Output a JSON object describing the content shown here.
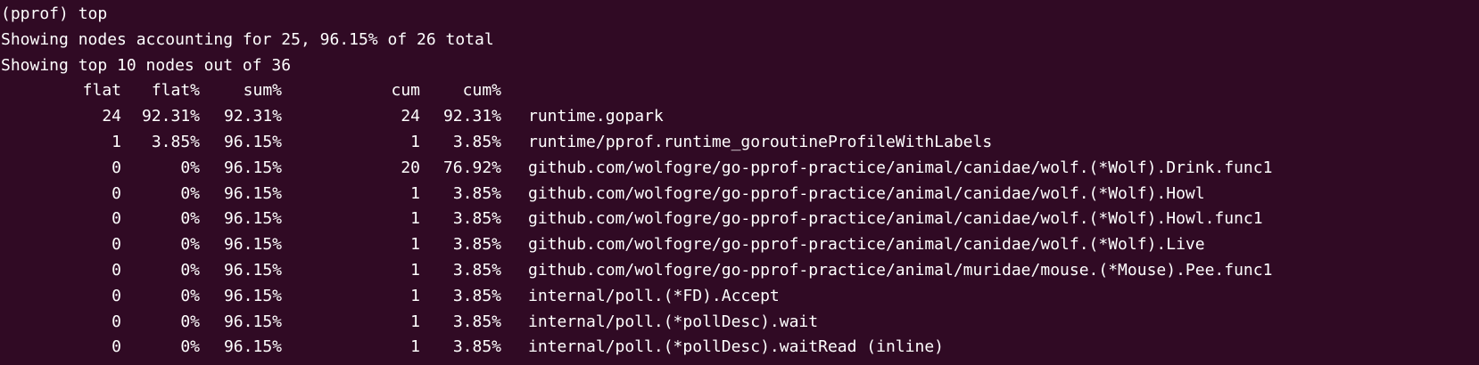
{
  "terminal": {
    "prompt_line": "(pprof) top",
    "summary_line_1": "Showing nodes accounting for 25, 96.15% of 26 total",
    "summary_line_2": "Showing top 10 nodes out of 36",
    "headers": {
      "flat": "flat",
      "flat_pct": "flat%",
      "sum_pct": "sum%",
      "cum": "cum",
      "cum_pct": "cum%"
    },
    "rows": [
      {
        "flat": "24",
        "flat_pct": "92.31%",
        "sum_pct": "92.31%",
        "cum": "24",
        "cum_pct": "92.31%",
        "name": "runtime.gopark"
      },
      {
        "flat": "1",
        "flat_pct": "3.85%",
        "sum_pct": "96.15%",
        "cum": "1",
        "cum_pct": "3.85%",
        "name": "runtime/pprof.runtime_goroutineProfileWithLabels"
      },
      {
        "flat": "0",
        "flat_pct": "0%",
        "sum_pct": "96.15%",
        "cum": "20",
        "cum_pct": "76.92%",
        "name": "github.com/wolfogre/go-pprof-practice/animal/canidae/wolf.(*Wolf).Drink.func1"
      },
      {
        "flat": "0",
        "flat_pct": "0%",
        "sum_pct": "96.15%",
        "cum": "1",
        "cum_pct": "3.85%",
        "name": "github.com/wolfogre/go-pprof-practice/animal/canidae/wolf.(*Wolf).Howl"
      },
      {
        "flat": "0",
        "flat_pct": "0%",
        "sum_pct": "96.15%",
        "cum": "1",
        "cum_pct": "3.85%",
        "name": "github.com/wolfogre/go-pprof-practice/animal/canidae/wolf.(*Wolf).Howl.func1"
      },
      {
        "flat": "0",
        "flat_pct": "0%",
        "sum_pct": "96.15%",
        "cum": "1",
        "cum_pct": "3.85%",
        "name": "github.com/wolfogre/go-pprof-practice/animal/canidae/wolf.(*Wolf).Live"
      },
      {
        "flat": "0",
        "flat_pct": "0%",
        "sum_pct": "96.15%",
        "cum": "1",
        "cum_pct": "3.85%",
        "name": "github.com/wolfogre/go-pprof-practice/animal/muridae/mouse.(*Mouse).Pee.func1"
      },
      {
        "flat": "0",
        "flat_pct": "0%",
        "sum_pct": "96.15%",
        "cum": "1",
        "cum_pct": "3.85%",
        "name": "internal/poll.(*FD).Accept"
      },
      {
        "flat": "0",
        "flat_pct": "0%",
        "sum_pct": "96.15%",
        "cum": "1",
        "cum_pct": "3.85%",
        "name": "internal/poll.(*pollDesc).wait"
      },
      {
        "flat": "0",
        "flat_pct": "0%",
        "sum_pct": "96.15%",
        "cum": "1",
        "cum_pct": "3.85%",
        "name": "internal/poll.(*pollDesc).waitRead (inline)"
      }
    ]
  },
  "colors": {
    "background": "#300a24",
    "foreground": "#ffffff"
  }
}
